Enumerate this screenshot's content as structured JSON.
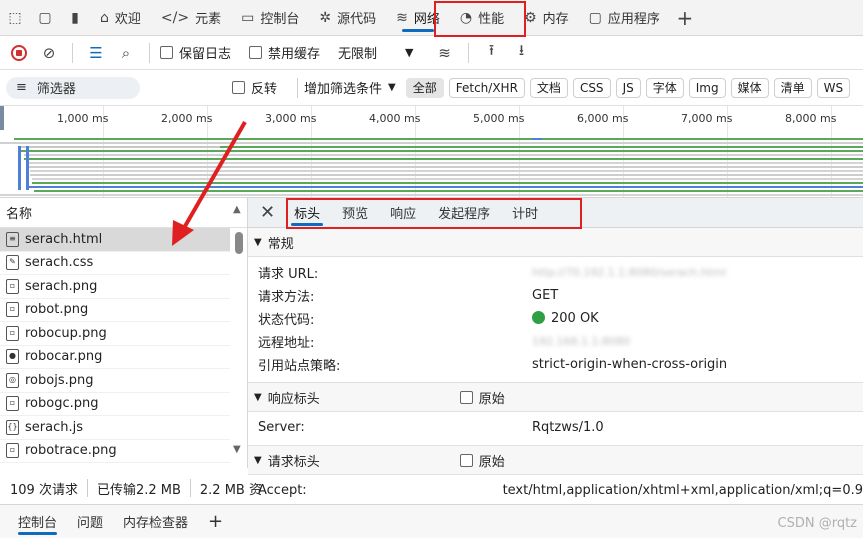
{
  "tabs": [
    {
      "label": "欢迎",
      "icon": "home-icon"
    },
    {
      "label": "元素",
      "icon": "code-icon"
    },
    {
      "label": "控制台",
      "icon": "console-icon"
    },
    {
      "label": "源代码",
      "icon": "bug-icon"
    },
    {
      "label": "网络",
      "icon": "wifi-icon",
      "active": true
    },
    {
      "label": "性能",
      "icon": "gauge-icon"
    },
    {
      "label": "内存",
      "icon": "chip-icon"
    },
    {
      "label": "应用程序",
      "icon": "app-icon"
    }
  ],
  "toolbar": {
    "preserve_log": "保留日志",
    "disable_cache": "禁用缓存",
    "throttle": "无限制"
  },
  "filter": {
    "input_label": "筛选器",
    "invert": "反转",
    "more_filters": "增加筛选条件",
    "types": [
      "全部",
      "Fetch/XHR",
      "文档",
      "CSS",
      "JS",
      "字体",
      "Img",
      "媒体",
      "清单",
      "WS"
    ]
  },
  "timeline": {
    "ticks": [
      "1,000 ms",
      "2,000 ms",
      "3,000 ms",
      "4,000 ms",
      "5,000 ms",
      "6,000 ms",
      "7,000 ms",
      "8,000 ms"
    ]
  },
  "request_list": {
    "header": "名称",
    "items": [
      "serach.html",
      "serach.css",
      "serach.png",
      "robot.png",
      "robocup.png",
      "robocar.png",
      "robojs.png",
      "robogc.png",
      "serach.js",
      "robotrace.png"
    ]
  },
  "status": {
    "requests": "109 次请求",
    "transferred": "已传输2.2 MB",
    "resources": "2.2 MB 资"
  },
  "detail": {
    "tabs": [
      "标头",
      "预览",
      "响应",
      "发起程序",
      "计时"
    ],
    "general": {
      "title": "常规",
      "rows": [
        {
          "key": "请求 URL:",
          "value": "http://70.192.1.1:8080/serach.html"
        },
        {
          "key": "请求方法:",
          "value": "GET"
        },
        {
          "key": "状态代码:",
          "value": "200 OK"
        },
        {
          "key": "远程地址:",
          "value": "192.168.1.1:8080"
        },
        {
          "key": "引用站点策略:",
          "value": "strict-origin-when-cross-origin"
        }
      ]
    },
    "response_headers": {
      "title": "响应标头",
      "raw_label": "原始",
      "rows": [
        {
          "key": "Server:",
          "value": "Rqtzws/1.0"
        }
      ]
    },
    "request_headers": {
      "title": "请求标头",
      "raw_label": "原始",
      "rows": [
        {
          "key": "Accept:",
          "value": "text/html,application/xhtml+xml,application/xml;q=0.9"
        }
      ]
    }
  },
  "drawer": {
    "tabs": [
      "控制台",
      "问题",
      "内存检查器"
    ]
  },
  "watermark": "CSDN @rqtz",
  "colors": {
    "accent": "#0f6cbd",
    "highlight_box": "#e02020",
    "arrow": "#e02020",
    "status_ok": "#2ea043"
  }
}
